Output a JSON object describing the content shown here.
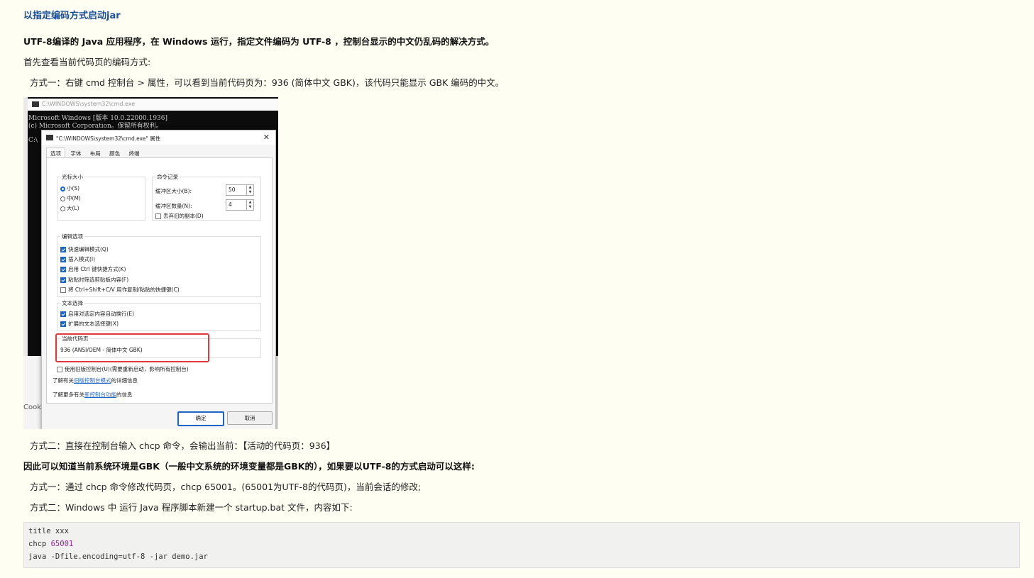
{
  "article": {
    "title": "以指定编码方式启动jar",
    "heading": "UTF-8编译的 Java 应用程序，在 Windows 运行，指定文件编码为 UTF-8 ，控制台显示的中文仍乱码的解决方式。",
    "intro": "首先查看当前代码页的编码方式:",
    "method1": "方式一：右键 cmd 控制台 > 属性，可以看到当前代码页为：936 (简体中文 GBK)，该代码只能显示 GBK 编码的中文。",
    "method2": "方式二：直接在控制台输入 chcp 命令，会输出当前：【活动的代码页：936】",
    "conclusion": "因此可以知道当前系统环境是GBK（一般中文系统的环境变量都是GBK的），如果要以UTF-8的方式启动可以这样:",
    "solution1": "方式一：通过 chcp 命令修改代码页，chcp 65001。(65001为UTF-8的代码页)，当前会话的修改;",
    "solution2": "方式二：Windows 中 运行 Java 程序脚本新建一个 startup.bat 文件，内容如下:"
  },
  "screenshot": {
    "cmd_title": "C:\\WINDOWS\\system32\\cmd.exe",
    "cmd_line1": "Microsoft Windows [版本 10.0.22000.1936]",
    "cmd_line2": "(c) Microsoft Corporation。保留所有权利。",
    "cmd_prompt": "C:\\",
    "cooki": "Cooki",
    "dialog_title": "\"C:\\WINDOWS\\system32\\cmd.exe\" 属性",
    "tabs": [
      "选项",
      "字体",
      "布局",
      "颜色",
      "终端"
    ],
    "cursor_size": {
      "label": "光标大小",
      "small": "小(S)",
      "medium": "中(M)",
      "large": "大(L)"
    },
    "history": {
      "label": "命令记录",
      "buffer_size_label": "缓冲区大小(B):",
      "buffer_size_value": "50",
      "buffer_count_label": "缓冲区数量(N):",
      "buffer_count_value": "4",
      "discard_label": "丢弃旧的副本(D)"
    },
    "edit_options": {
      "label": "编辑选项",
      "items": [
        "快速编辑模式(Q)",
        "插入模式(I)",
        "启用 Ctrl 键快捷方式(K)",
        "粘贴时筛选剪贴板内容(F)",
        "将 Ctrl+Shift+C/V 用作复制/粘贴的快捷键(C)"
      ]
    },
    "text_select": {
      "label": "文本选择",
      "items": [
        "启用对选定内容自动换行(E)",
        "扩展的文本选择键(X)"
      ]
    },
    "codepage": {
      "label": "当前代码页",
      "value": "936 (ANSI/OEM - 简体中文 GBK)"
    },
    "legacy_label": "使用旧版控制台(U)(需要重新启动，影响所有控制台)",
    "learn_legacy_prefix": "了解有关",
    "learn_legacy_link": "旧版控制台模式",
    "learn_legacy_suffix": "的详细信息",
    "learn_new_prefix": "了解更多有关",
    "learn_new_link": "新控制台功能",
    "learn_new_suffix": "的信息",
    "ok_label": "确定",
    "cancel_label": "取消"
  },
  "code": {
    "line1": "title xxx",
    "line2_cmd": "chcp ",
    "line2_num": "65001",
    "line3": "java -Dfile.encoding=utf-8 -jar demo.jar"
  }
}
